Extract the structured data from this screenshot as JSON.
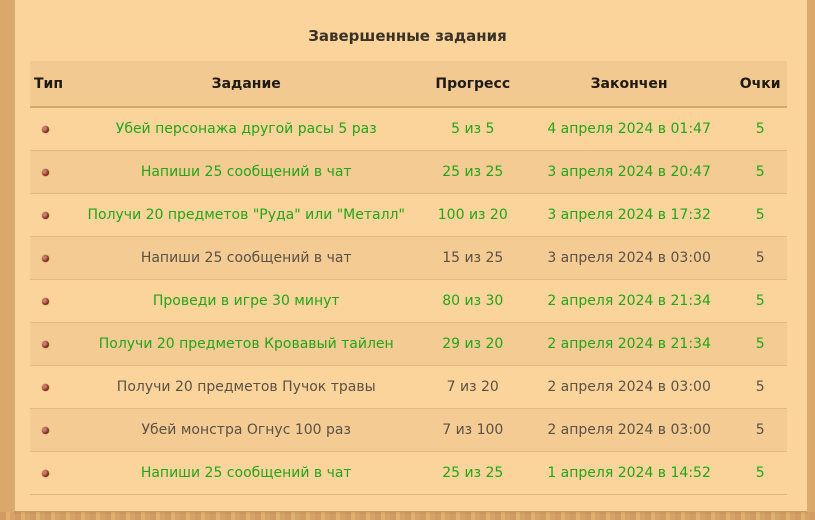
{
  "title": "Завершенные задания",
  "columns": {
    "type": "Тип",
    "task": "Задание",
    "progress": "Прогресс",
    "finished": "Закончен",
    "points": "Очки"
  },
  "rows": [
    {
      "task": "Убей персонажа другой расы 5 раз",
      "progress": "5 из 5",
      "finished": "4 апреля 2024 в 01:47",
      "points": "5",
      "completed": true
    },
    {
      "task": "Напиши 25 сообщений в чат",
      "progress": "25 из 25",
      "finished": "3 апреля 2024 в 20:47",
      "points": "5",
      "completed": true
    },
    {
      "task": "Получи 20 предметов \"Руда\" или \"Металл\"",
      "progress": "100 из 20",
      "finished": "3 апреля 2024 в 17:32",
      "points": "5",
      "completed": true
    },
    {
      "task": "Напиши 25 сообщений в чат",
      "progress": "15 из 25",
      "finished": "3 апреля 2024 в 03:00",
      "points": "5",
      "completed": false
    },
    {
      "task": "Проведи в игре 30 минут",
      "progress": "80 из 30",
      "finished": "2 апреля 2024 в 21:34",
      "points": "5",
      "completed": true
    },
    {
      "task": "Получи 20 предметов Кровавый тайлен",
      "progress": "29 из 20",
      "finished": "2 апреля 2024 в 21:34",
      "points": "5",
      "completed": true
    },
    {
      "task": "Получи 20 предметов Пучок травы",
      "progress": "7 из 20",
      "finished": "2 апреля 2024 в 03:00",
      "points": "5",
      "completed": false
    },
    {
      "task": "Убей монстра Огнус 100 раз",
      "progress": "7 из 100",
      "finished": "2 апреля 2024 в 03:00",
      "points": "5",
      "completed": false
    },
    {
      "task": "Напиши 25 сообщений в чат",
      "progress": "25 из 25",
      "finished": "1 апреля 2024 в 14:52",
      "points": "5",
      "completed": true
    }
  ],
  "colors": {
    "completed_text": "#22a519",
    "pending_text": "#5a5247",
    "parchment": "#fad49a",
    "row_alt": "#f3cb93"
  },
  "icons": {
    "type_marker": "quest-type-dot-icon"
  }
}
